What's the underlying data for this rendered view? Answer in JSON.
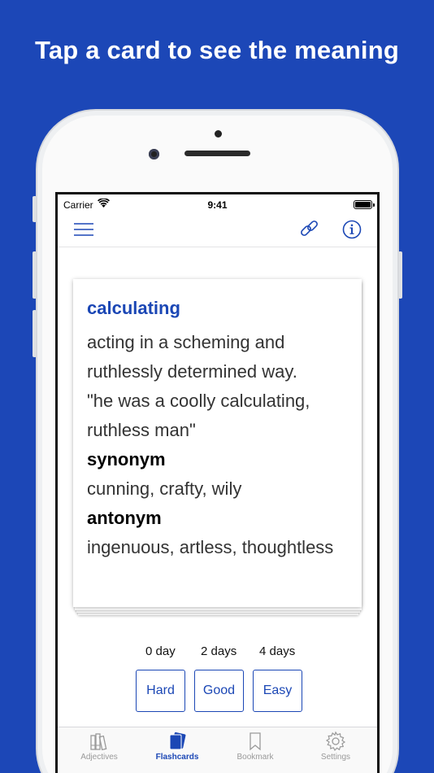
{
  "headline": "Tap a card to see the meaning",
  "status": {
    "carrier": "Carrier",
    "time": "9:41"
  },
  "card": {
    "word": "calculating",
    "definition_1": "acting in a scheming and",
    "definition_2": "ruthlessly determined way.",
    "example_1": "\"he was a coolly calculating,",
    "example_2": "ruthless man\"",
    "synonym_label": "synonym",
    "synonyms": "cunning, crafty, wily",
    "antonym_label": "antonym",
    "antonyms": "ingenuous, artless, thoughtless"
  },
  "intervals": [
    "0 day",
    "2 days",
    "4 days"
  ],
  "rating": {
    "hard": "Hard",
    "good": "Good",
    "easy": "Easy"
  },
  "tabs": [
    {
      "label": "Adjectives",
      "icon": "books-icon"
    },
    {
      "label": "Flashcards",
      "icon": "cards-icon",
      "active": true
    },
    {
      "label": "Bookmark",
      "icon": "bookmark-icon"
    },
    {
      "label": "Settings",
      "icon": "gear-icon"
    }
  ],
  "colors": {
    "background": "#1c47b7",
    "accent": "#1b47b5"
  }
}
